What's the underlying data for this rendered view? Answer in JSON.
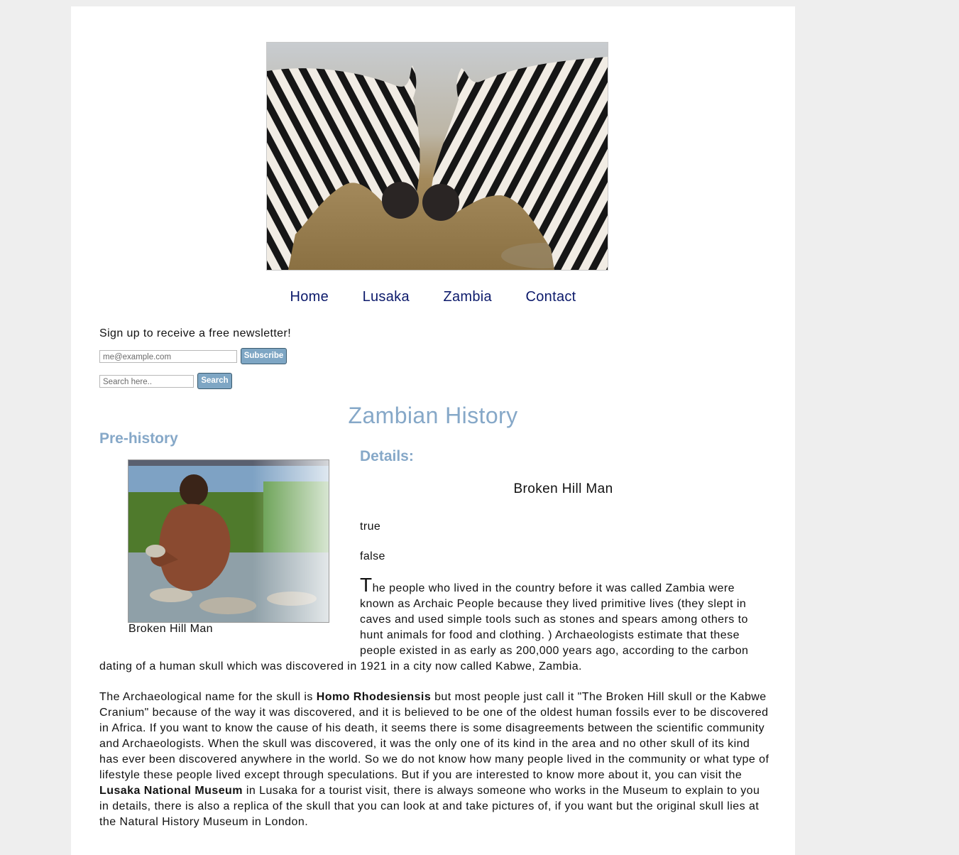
{
  "nav": {
    "items": [
      "Home",
      "Lusaka",
      "Zambia",
      "Contact"
    ]
  },
  "newsletter": {
    "label": "Sign up to receive a free newsletter!",
    "email_placeholder": "me@example.com",
    "subscribe_label": "Subscribe"
  },
  "search": {
    "placeholder": "Search here..",
    "button_label": "Search"
  },
  "main": {
    "title": "Zambian History",
    "section_title": "Pre-history",
    "figure_caption": "Broken Hill Man",
    "details_heading": "Details:",
    "details_title": "Broken Hill Man",
    "value_true": "true",
    "value_false": "false",
    "para1_dropcap": "T",
    "para1_text": "he people who lived in the country before it was called Zambia were known as Archaic People because they lived primitive lives (they slept in caves and used simple tools such as stones and spears among others to hunt animals for food and clothing. ) Archaeologists estimate that these people existed in as early as 200,000 years ago, according to the carbon dating of a human skull which was discovered in 1921 in a city now called Kabwe, Zambia.",
    "para2_a": "The Archaeological name for the skull is ",
    "para2_bold1": "Homo Rhodesiensis",
    "para2_b": " but most people just call it \"The Broken Hill skull or the Kabwe Cranium\" because of the way it was discovered, and it is believed to be one of the oldest human fossils ever to be discovered in Africa. If you want to know the cause of his death, it seems there is some disagreements between the scientific community and Archaeologists. When the skull was discovered, it was the only one of its kind in the area and no other skull of its kind has ever been discovered anywhere in the world. So we do not know how many people lived in the community or what type of lifestyle these people lived except through speculations. But if you are interested to know more about it, you can visit the ",
    "para2_bold2": "Lusaka National Museum",
    "para2_c": " in Lusaka for a tourist visit, there is always someone who works in the Museum to explain to you in details, there is also a replica of the skull that you can look at and take pictures of, if you want but the original skull lies at the Natural History Museum in London."
  },
  "colors": {
    "heading_blue": "#86a8c8",
    "nav_link": "#0c1a6b",
    "button_bg": "#7ea6c4"
  }
}
